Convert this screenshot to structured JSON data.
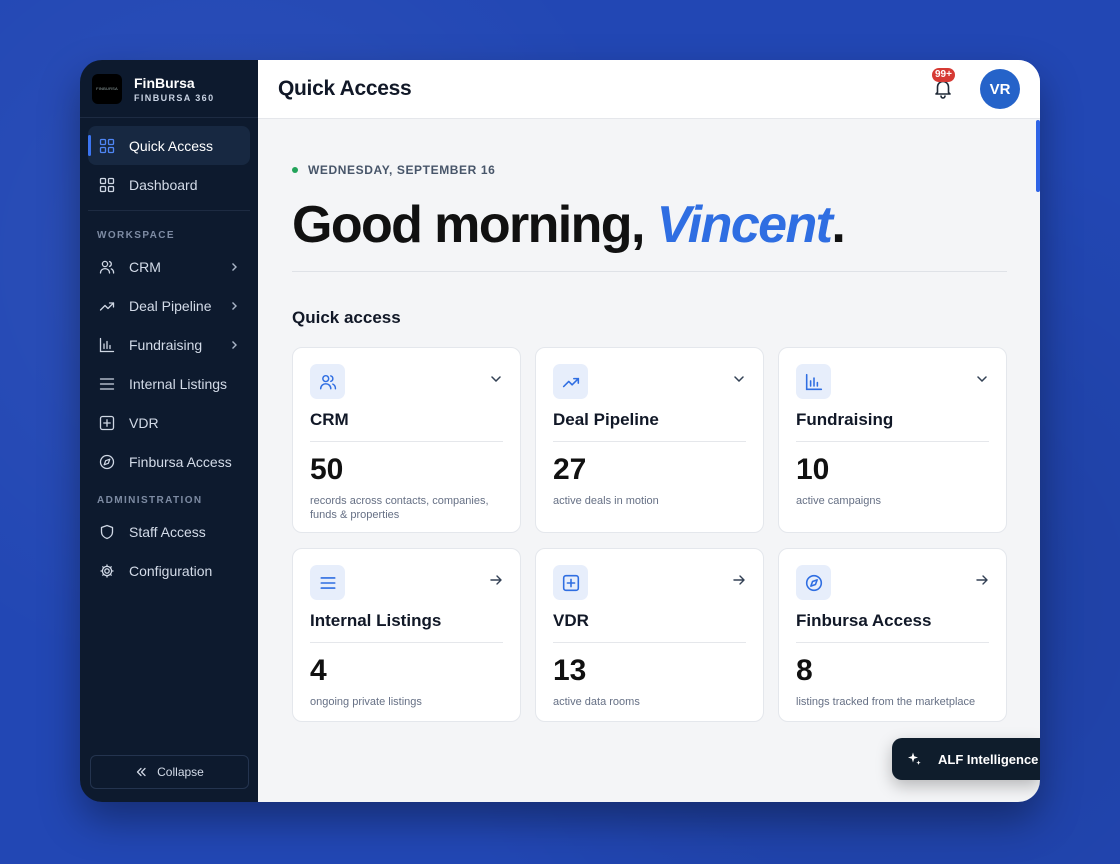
{
  "brand": {
    "logo_text": "FINBURSA",
    "name": "FinBursa",
    "subtitle": "FINBURSA 360"
  },
  "nav": {
    "top": [
      {
        "label": "Quick Access",
        "icon": "grid-icon",
        "active": true
      },
      {
        "label": "Dashboard",
        "icon": "grid-icon"
      }
    ],
    "workspace_title": "WORKSPACE",
    "workspace": [
      {
        "label": "CRM",
        "icon": "users-icon",
        "chevron": true
      },
      {
        "label": "Deal Pipeline",
        "icon": "trend-icon",
        "chevron": true
      },
      {
        "label": "Fundraising",
        "icon": "bar-chart-icon",
        "chevron": true
      },
      {
        "label": "Internal Listings",
        "icon": "list-icon"
      },
      {
        "label": "VDR",
        "icon": "plus-square-icon"
      },
      {
        "label": "Finbursa Access",
        "icon": "compass-icon"
      }
    ],
    "admin_title": "ADMINISTRATION",
    "admin": [
      {
        "label": "Staff Access",
        "icon": "shield-icon"
      },
      {
        "label": "Configuration",
        "icon": "gear-icon"
      }
    ],
    "collapse_label": "Collapse"
  },
  "topbar": {
    "title": "Quick Access",
    "notif_count": "99+",
    "avatar_initials": "VR"
  },
  "hero": {
    "date": "WEDNESDAY, SEPTEMBER 16",
    "greeting_prefix": "Good morning, ",
    "user_name": "Vincent",
    "greeting_suffix": "."
  },
  "quick_access": {
    "title": "Quick access",
    "cards": [
      {
        "title": "CRM",
        "value": "50",
        "desc": "records across contacts, companies, funds & properties",
        "icon": "users-icon",
        "action": "chevron-down-icon"
      },
      {
        "title": "Deal Pipeline",
        "value": "27",
        "desc": "active deals in motion",
        "icon": "trend-icon",
        "action": "chevron-down-icon"
      },
      {
        "title": "Fundraising",
        "value": "10",
        "desc": "active campaigns",
        "icon": "bar-chart-icon",
        "action": "chevron-down-icon"
      },
      {
        "title": "Internal Listings",
        "value": "4",
        "desc": "ongoing private listings",
        "icon": "list-icon",
        "action": "arrow-right-icon"
      },
      {
        "title": "VDR",
        "value": "13",
        "desc": "active data rooms",
        "icon": "plus-square-icon",
        "action": "arrow-right-icon"
      },
      {
        "title": "Finbursa Access",
        "value": "8",
        "desc": "listings tracked from the marketplace",
        "icon": "compass-icon",
        "action": "arrow-right-icon"
      }
    ]
  },
  "assistant": {
    "label": "ALF Intelligence",
    "icon": "sparkle-icon"
  },
  "colors": {
    "accent": "#2f6ee2",
    "sidebar_bg": "#0d1a2e",
    "badge": "#d63a34",
    "status_dot": "#22a35a"
  }
}
